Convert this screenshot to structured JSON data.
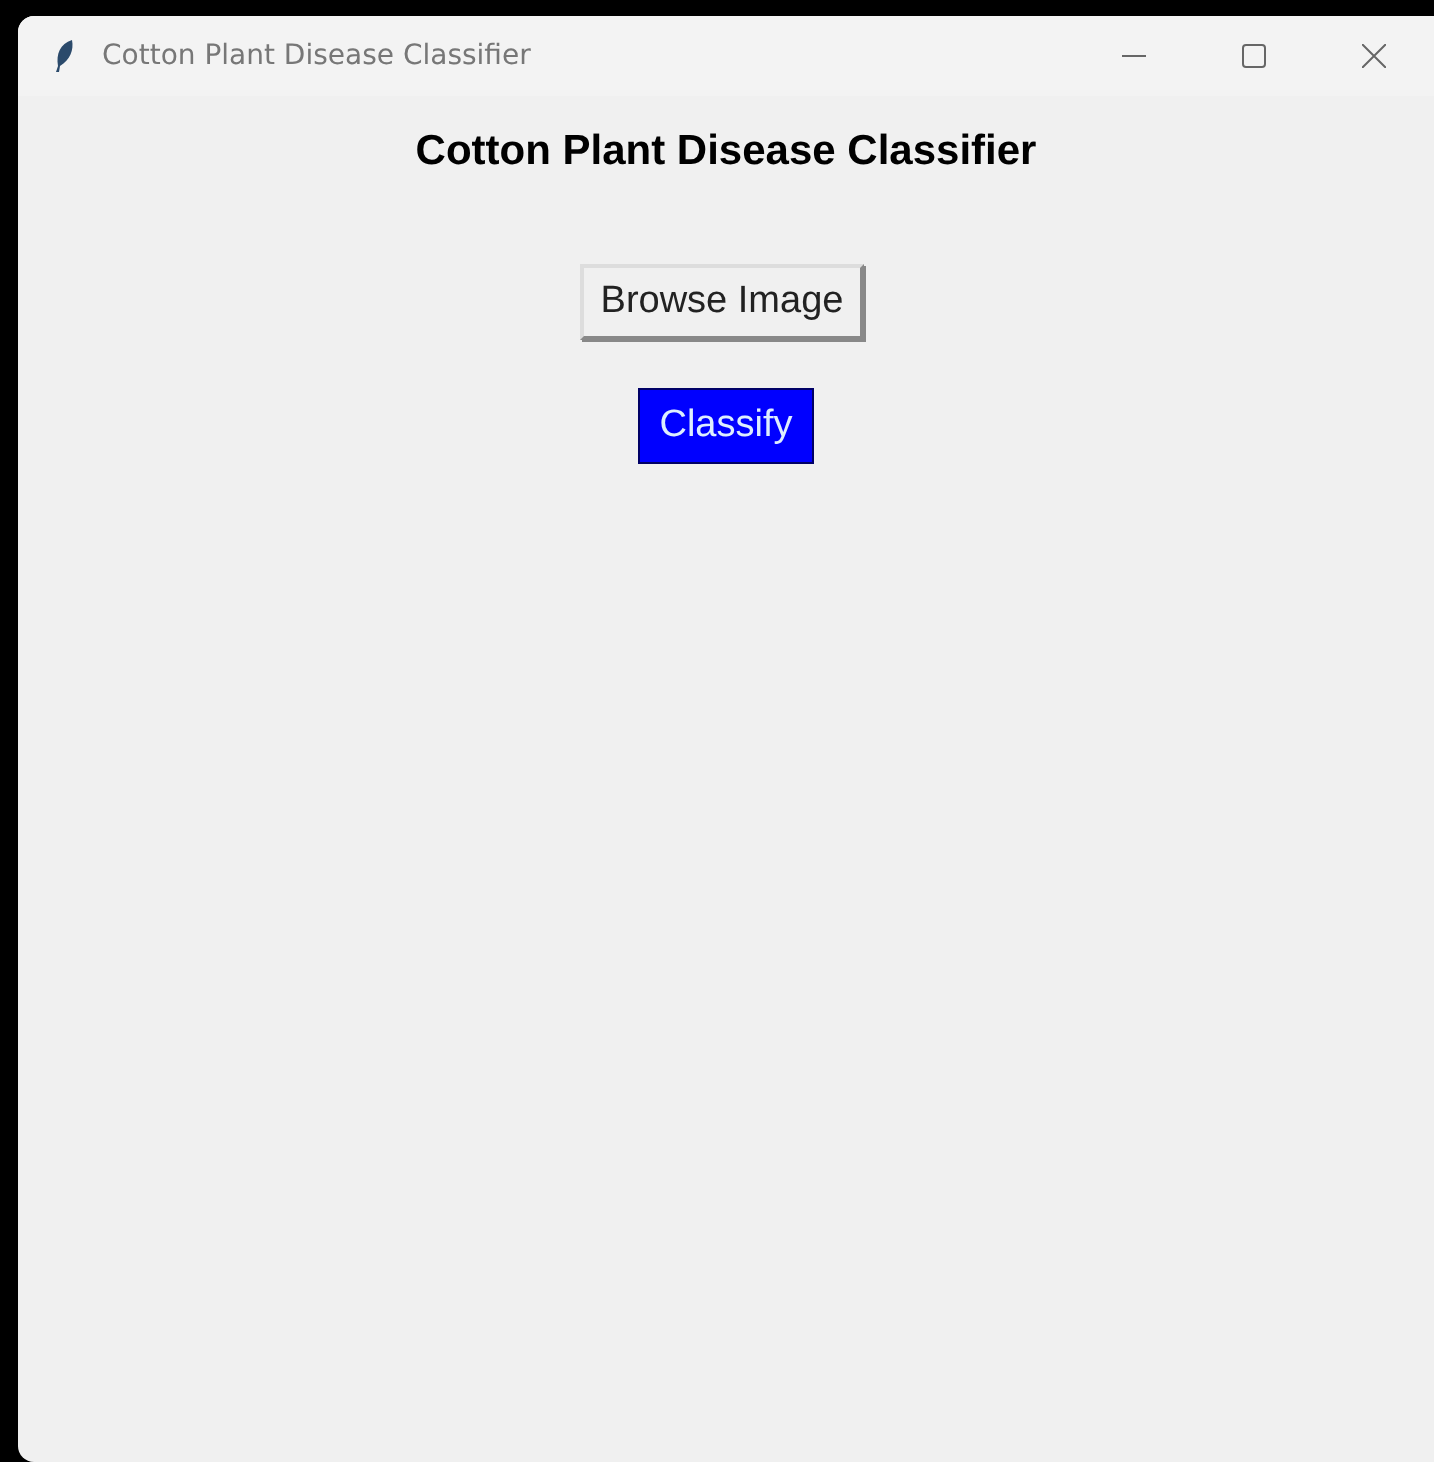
{
  "window": {
    "title": "Cotton Plant Disease Classifier"
  },
  "heading": "Cotton Plant Disease Classifier",
  "buttons": [
    {
      "label": "Browse Image",
      "kind": "default"
    },
    {
      "label": "Classify",
      "kind": "accent"
    }
  ]
}
